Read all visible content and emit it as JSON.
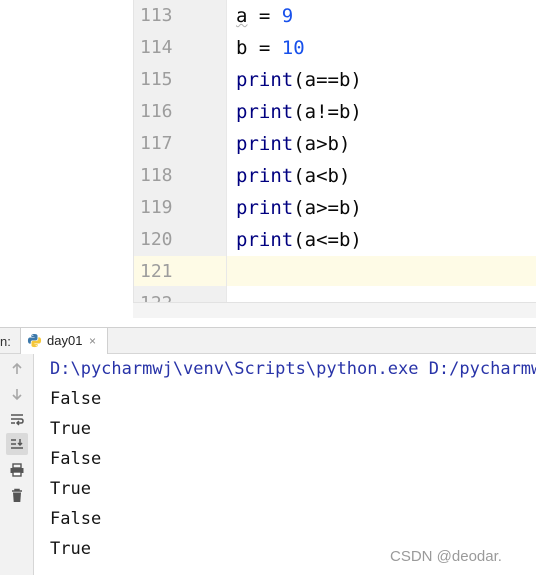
{
  "editor": {
    "line_numbers": [
      "113",
      "114",
      "115",
      "116",
      "117",
      "118",
      "119",
      "120",
      "121",
      "122"
    ],
    "lines": [
      {
        "parts": [
          {
            "t": "a",
            "c": "typo"
          },
          {
            "t": " = ",
            "c": ""
          },
          {
            "t": "9",
            "c": "num"
          }
        ]
      },
      {
        "parts": [
          {
            "t": "b",
            "c": ""
          },
          {
            "t": " = ",
            "c": ""
          },
          {
            "t": "10",
            "c": "num"
          }
        ]
      },
      {
        "parts": [
          {
            "t": "print",
            "c": "kw-print"
          },
          {
            "t": "(a==b)",
            "c": ""
          }
        ]
      },
      {
        "parts": [
          {
            "t": "print",
            "c": "kw-print"
          },
          {
            "t": "(a!=b)",
            "c": ""
          }
        ]
      },
      {
        "parts": [
          {
            "t": "print",
            "c": "kw-print"
          },
          {
            "t": "(a>b)",
            "c": ""
          }
        ]
      },
      {
        "parts": [
          {
            "t": "print",
            "c": "kw-print"
          },
          {
            "t": "(a<b)",
            "c": ""
          }
        ]
      },
      {
        "parts": [
          {
            "t": "print",
            "c": "kw-print"
          },
          {
            "t": "(a>=b)",
            "c": ""
          }
        ]
      },
      {
        "parts": [
          {
            "t": "print",
            "c": "kw-print"
          },
          {
            "t": "(a<=b)",
            "c": ""
          }
        ]
      },
      {
        "parts": []
      },
      {
        "parts": []
      }
    ],
    "current_line": "121"
  },
  "run_panel": {
    "label": "n:",
    "tab_label": "day01",
    "tab_close": "×",
    "tab_icon": "python-icon"
  },
  "toolbar": {
    "buttons": [
      "up-arrow-icon",
      "down-arrow-icon",
      "soft-wrap-icon",
      "scroll-to-end-icon",
      "print-icon",
      "trash-icon"
    ]
  },
  "console": {
    "command": "D:\\pycharmwj\\venv\\Scripts\\python.exe D:/pycharmwj",
    "output": [
      "False",
      "True",
      "False",
      "True",
      "False",
      "True"
    ]
  },
  "watermark": "CSDN @deodar.",
  "colors": {
    "gutter_bg": "#f0f0f0",
    "current_line_bg": "#fefbe6",
    "keyword": "#000080",
    "number": "#1750eb",
    "console_cmd": "#2833a8"
  }
}
